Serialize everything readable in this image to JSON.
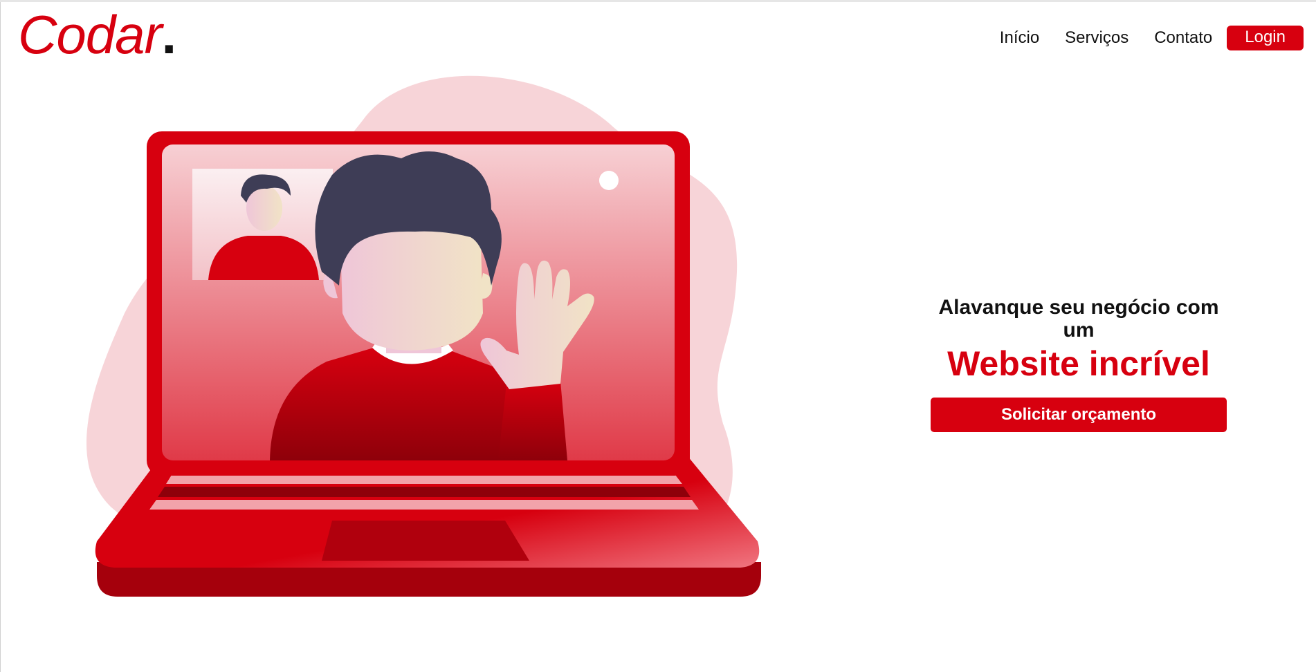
{
  "header": {
    "logo_text": "Codar",
    "logo_dot": ".",
    "nav": {
      "inicio": "Início",
      "servicos": "Serviços",
      "contato": "Contato",
      "login": "Login"
    }
  },
  "hero": {
    "headline_line1": "Alavanque seu negócio com um",
    "headline_line2": "Website incrível",
    "cta_label": "Solicitar orçamento"
  },
  "colors": {
    "brand": "#d7000f",
    "blob": "#f7d4d8",
    "hair": "#3e3d56"
  }
}
